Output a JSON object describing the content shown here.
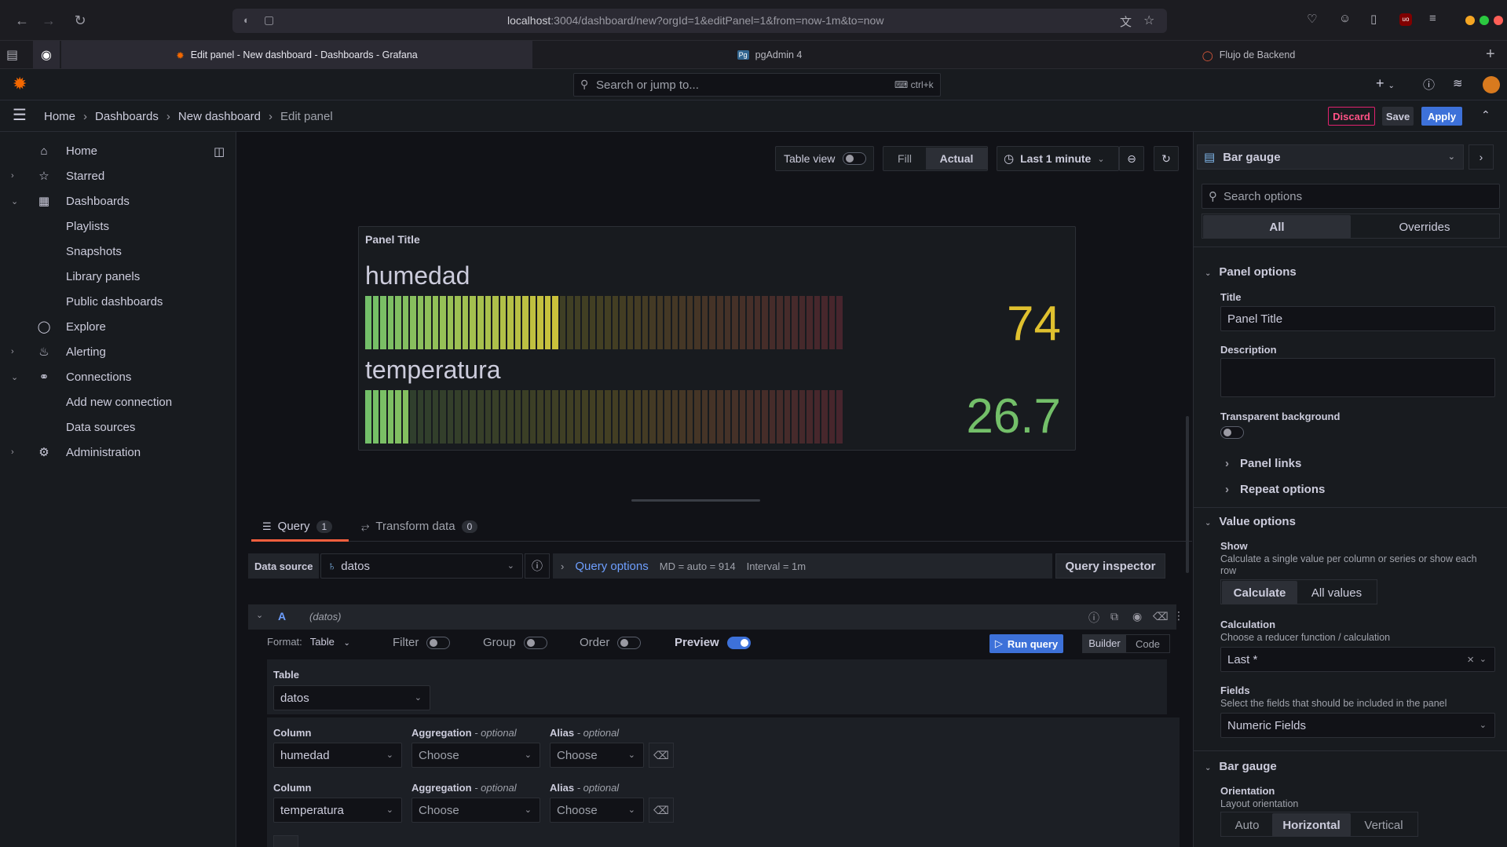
{
  "browser": {
    "url_host": "localhost",
    "url_path": ":3004/dashboard/new?orgId=1&editPanel=1&from=now-1m&to=now",
    "tabs": [
      {
        "label": "Edit panel - New dashboard - Dashboards - Grafana"
      },
      {
        "label": "pgAdmin 4"
      },
      {
        "label": "Flujo de Backend"
      }
    ]
  },
  "topbar": {
    "search_placeholder": "Search or jump to...",
    "shortcut": "ctrl+k"
  },
  "breadcrumb": {
    "items": [
      "Home",
      "Dashboards",
      "New dashboard",
      "Edit panel"
    ]
  },
  "actions": {
    "discard": "Discard",
    "save": "Save",
    "apply": "Apply"
  },
  "sidebar": {
    "items": [
      {
        "label": "Home"
      },
      {
        "label": "Starred"
      },
      {
        "label": "Dashboards"
      },
      {
        "label": "Playlists"
      },
      {
        "label": "Snapshots"
      },
      {
        "label": "Library panels"
      },
      {
        "label": "Public dashboards"
      },
      {
        "label": "Explore"
      },
      {
        "label": "Alerting"
      },
      {
        "label": "Connections"
      },
      {
        "label": "Add new connection"
      },
      {
        "label": "Data sources"
      },
      {
        "label": "Administration"
      }
    ]
  },
  "toolbar": {
    "table_view": "Table view",
    "fill": "Fill",
    "actual": "Actual",
    "time_range": "Last 1 minute"
  },
  "panel": {
    "title": "Panel Title",
    "gauges": [
      {
        "name": "humedad",
        "value": "74",
        "fill_fraction": 0.41,
        "color": "#e0c12f"
      },
      {
        "name": "temperatura",
        "value": "26.7",
        "fill_fraction": 0.095,
        "color": "#73bf69"
      }
    ]
  },
  "query_tabs": {
    "query": "Query",
    "query_count": "1",
    "transform": "Transform data",
    "transform_count": "0"
  },
  "datasource": {
    "label": "Data source",
    "value": "datos",
    "query_options": "Query options",
    "md": "MD = auto = 914",
    "interval": "Interval = 1m",
    "inspector": "Query inspector"
  },
  "query": {
    "ref": "A",
    "ds_hint": "(datos)",
    "format_label": "Format:",
    "format_value": "Table",
    "filter": "Filter",
    "group": "Group",
    "order": "Order",
    "preview": "Preview",
    "run": "Run query",
    "builder": "Builder",
    "code": "Code",
    "table_label": "Table",
    "table_value": "datos",
    "column_label": "Column",
    "aggregation_label": "Aggregation",
    "alias_label": "Alias",
    "optional": "- optional",
    "rows": [
      {
        "column": "humedad",
        "aggregation": "Choose",
        "alias": "Choose"
      },
      {
        "column": "temperatura",
        "aggregation": "Choose",
        "alias": "Choose"
      }
    ]
  },
  "options": {
    "viz": "Bar gauge",
    "search_placeholder": "Search options",
    "all": "All",
    "overrides": "Overrides",
    "panel_options": "Panel options",
    "title_label": "Title",
    "title_value": "Panel Title",
    "description_label": "Description",
    "transparent": "Transparent background",
    "panel_links": "Panel links",
    "repeat_options": "Repeat options",
    "value_options": "Value options",
    "show_label": "Show",
    "show_desc": "Calculate a single value per column or series or show each row",
    "calculate": "Calculate",
    "all_values": "All values",
    "calc_label": "Calculation",
    "calc_desc": "Choose a reducer function / calculation",
    "calc_value": "Last *",
    "fields_label": "Fields",
    "fields_desc": "Select the fields that should be included in the panel",
    "fields_value": "Numeric Fields",
    "bar_gauge": "Bar gauge",
    "orientation_label": "Orientation",
    "orientation_desc": "Layout orientation",
    "auto": "Auto",
    "horizontal": "Horizontal",
    "vertical": "Vertical"
  }
}
